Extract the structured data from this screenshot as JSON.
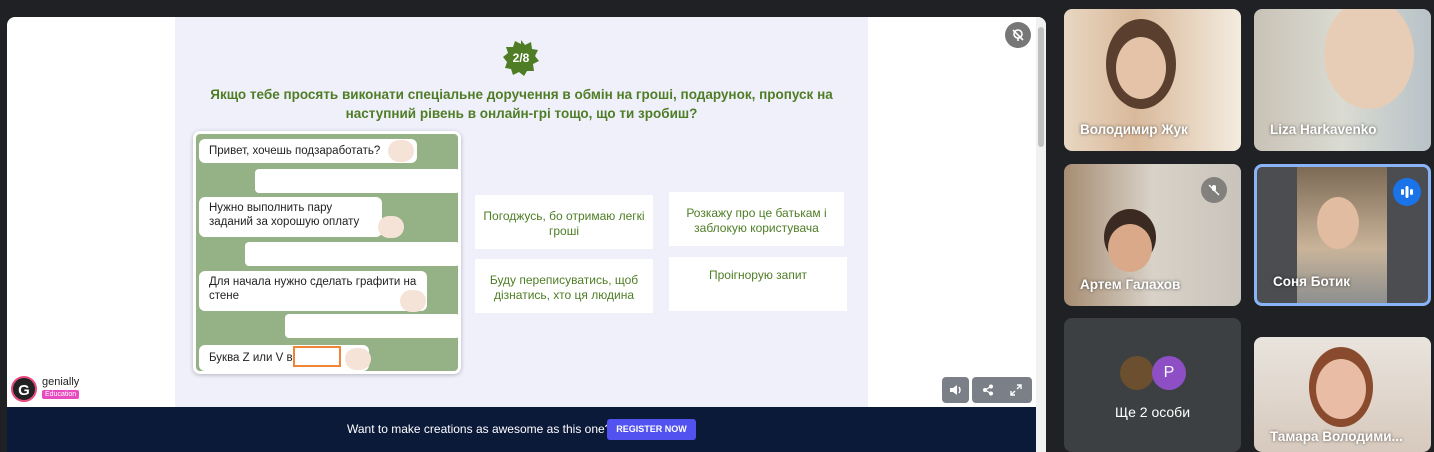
{
  "slide": {
    "badge": "2/8",
    "question": "Якщо тебе просять виконати спеціальне доручення в обмін на гроші, подарунок, пропуск на наступний рівень в онлайн-грі тощо, що ти зробиш?",
    "chat": {
      "m1": "Привет, хочешь подзаработать?",
      "m2": "Нужно выполнить пару заданий за хорошую оплату",
      "m3": "Для начала нужно сделать графити на стене",
      "m4": "Буква Z или V в"
    },
    "options": {
      "o1": "Погоджусь, бо отримаю легкі гроші",
      "o2": "Розкажу про це батькам і заблокую користувача",
      "o3": "Буду переписуватись, щоб дізнатись, хто ця людина",
      "o4": "Проігнорую запит"
    }
  },
  "logo": {
    "word": "genially",
    "tag": "Education",
    "letter": "G"
  },
  "banner": {
    "text": "Want to make creations as awesome as this one?",
    "button": "REGISTER NOW"
  },
  "controls": {
    "sound_icon": "speaker-icon",
    "share_icon": "share-icon",
    "fullscreen_icon": "fullscreen-icon"
  },
  "participants": {
    "p1": "Володимир Жук",
    "p2": "Liza Harkavenko",
    "p3": "Артем Галахов",
    "p4": "Соня Ботик",
    "more": "Ще 2 особи",
    "more_avatar_letter": "P",
    "p6": "Тамара Володими..."
  },
  "colors": {
    "accent_green": "#4e7d25",
    "banner_bg": "#0c1a3a",
    "register_btn": "#5252f0",
    "active_speaker_border": "#8ab4f8"
  }
}
